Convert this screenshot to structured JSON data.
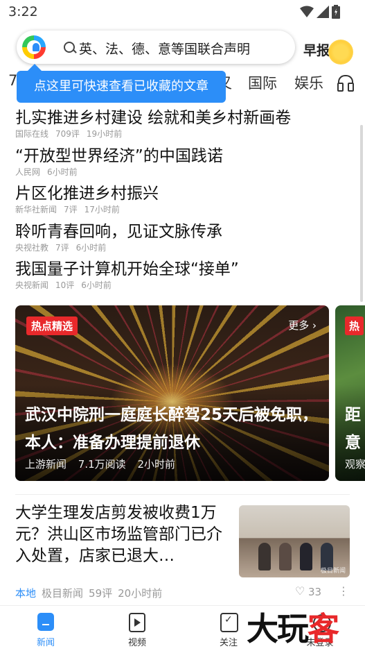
{
  "status_bar": {
    "time": "3:22"
  },
  "search": {
    "placeholder": "英、法、德、意等国联合声明"
  },
  "morning_report": {
    "label": "早报"
  },
  "tabs": [
    {
      "label": "7"
    },
    {
      "label": "又"
    },
    {
      "label": "国际"
    },
    {
      "label": "娱乐"
    }
  ],
  "tooltip": {
    "text": "点这里可快速查看已收藏的文章"
  },
  "headlines": [
    {
      "title": "扎实推进乡村建设 绘就和美乡村新画卷",
      "source": "国际在线",
      "comments": "709评",
      "time": "19小时前"
    },
    {
      "title": "“开放型世界经济”的中国践诺",
      "source": "人民网",
      "comments": "",
      "time": "6小时前"
    },
    {
      "title": "片区化推进乡村振兴",
      "source": "新华社新闻",
      "comments": "7评",
      "time": "17小时前"
    },
    {
      "title": "聆听青春回响，见证文脉传承",
      "source": "央视社教",
      "comments": "7评",
      "time": "6小时前"
    },
    {
      "title": "我国量子计算机开始全球“接单”",
      "source": "央视新闻",
      "comments": "10评",
      "time": "6小时前"
    }
  ],
  "hot_card": {
    "badge": "热点精选",
    "more": "更多 ›",
    "title": "武汉中院刑一庭庭长醉驾25天后被免职，本人：准备办理提前退休",
    "source": "上游新闻",
    "reads": "7.1万阅读",
    "time": "2小时前"
  },
  "hot_card_next": {
    "badge": "热",
    "title": "距\n意",
    "meta": "观察"
  },
  "article": {
    "title": "大学生理发店剪发被收费1万元？洪山区市场监管部门已介入处置，店家已退大…",
    "tag": "本地",
    "source": "极目新闻",
    "comments": "59评",
    "time": "20小时前",
    "likes": "33",
    "thumb_watermark": "极目新闻"
  },
  "bottom_nav": [
    {
      "label": "新闻",
      "icon": "news-icon"
    },
    {
      "label": "视频",
      "icon": "video-icon"
    },
    {
      "label": "关注",
      "icon": "follow-icon"
    },
    {
      "label": "未登录",
      "icon": "user-icon"
    }
  ],
  "watermark": {
    "part1": "大玩",
    "part2": "客"
  },
  "colors": {
    "accent": "#2c8ef8",
    "badge_red": "#e8292b"
  }
}
